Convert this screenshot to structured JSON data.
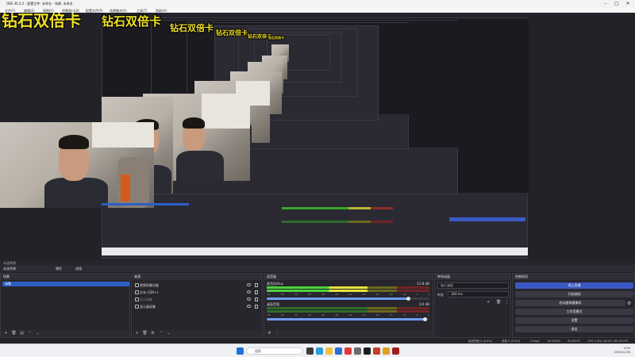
{
  "window": {
    "title": "OBS 30.2.2 - 配置文件: 未命名 - 场景: 未命名"
  },
  "menu": [
    "文件(F)",
    "编辑(E)",
    "视图(V)",
    "停靠窗口(D)",
    "配置文件(P)",
    "场景集合(S)",
    "工具(T)",
    "帮助(H)"
  ],
  "overlay": {
    "text": "钻石双倍卡"
  },
  "scene_bar": {
    "label": "未选择源",
    "props": "属性",
    "filters": "滤镜"
  },
  "docks": {
    "scenes": {
      "title": "场景",
      "items": [
        "场景"
      ]
    },
    "sources": {
      "title": "来源",
      "items": [
        "视频采集设备",
        "文本 (GDI+)",
        "显示采集",
        "显示器采集"
      ]
    },
    "mixer": {
      "title": "混音器",
      "channels": [
        {
          "name": "麦克风/Aux",
          "db": "-12.8 dB",
          "level": 0.62
        },
        {
          "name": "桌面音频",
          "db": "0.0 dB",
          "level": 0.0
        }
      ],
      "ticks": [
        "-60",
        "-55",
        "-50",
        "-45",
        "-40",
        "-35",
        "-30",
        "-25",
        "-20",
        "-15",
        "-10",
        "-5",
        "0"
      ]
    },
    "transitions": {
      "title": "转场动画",
      "type": "淡入淡出",
      "duration_label": "时长",
      "duration": "300 ms"
    },
    "controls": {
      "title": "控制按钮",
      "buttons": [
        "停止直播",
        "开始录制",
        "启动虚拟摄像机",
        "工作室模式",
        "设置",
        "退出"
      ]
    }
  },
  "status": {
    "frames": "丢帧 0 (0.0%)",
    "bitrate": "0 kbps",
    "live": "00:00:00",
    "rec": "00:00:00",
    "cpu": "CPU: 0.8%, 60.00 / 60.00 FPS",
    "dropped": "延迟的帧 0 (0.0%)"
  },
  "taskbar": {
    "search": "搜索",
    "time": "9:09",
    "date": "2025/11/16"
  },
  "colors": {
    "accent": "#3b59c5",
    "overlay": "#f0e028",
    "meter_green": "#4cd33a",
    "scene_selected": "#2d5fc4"
  }
}
